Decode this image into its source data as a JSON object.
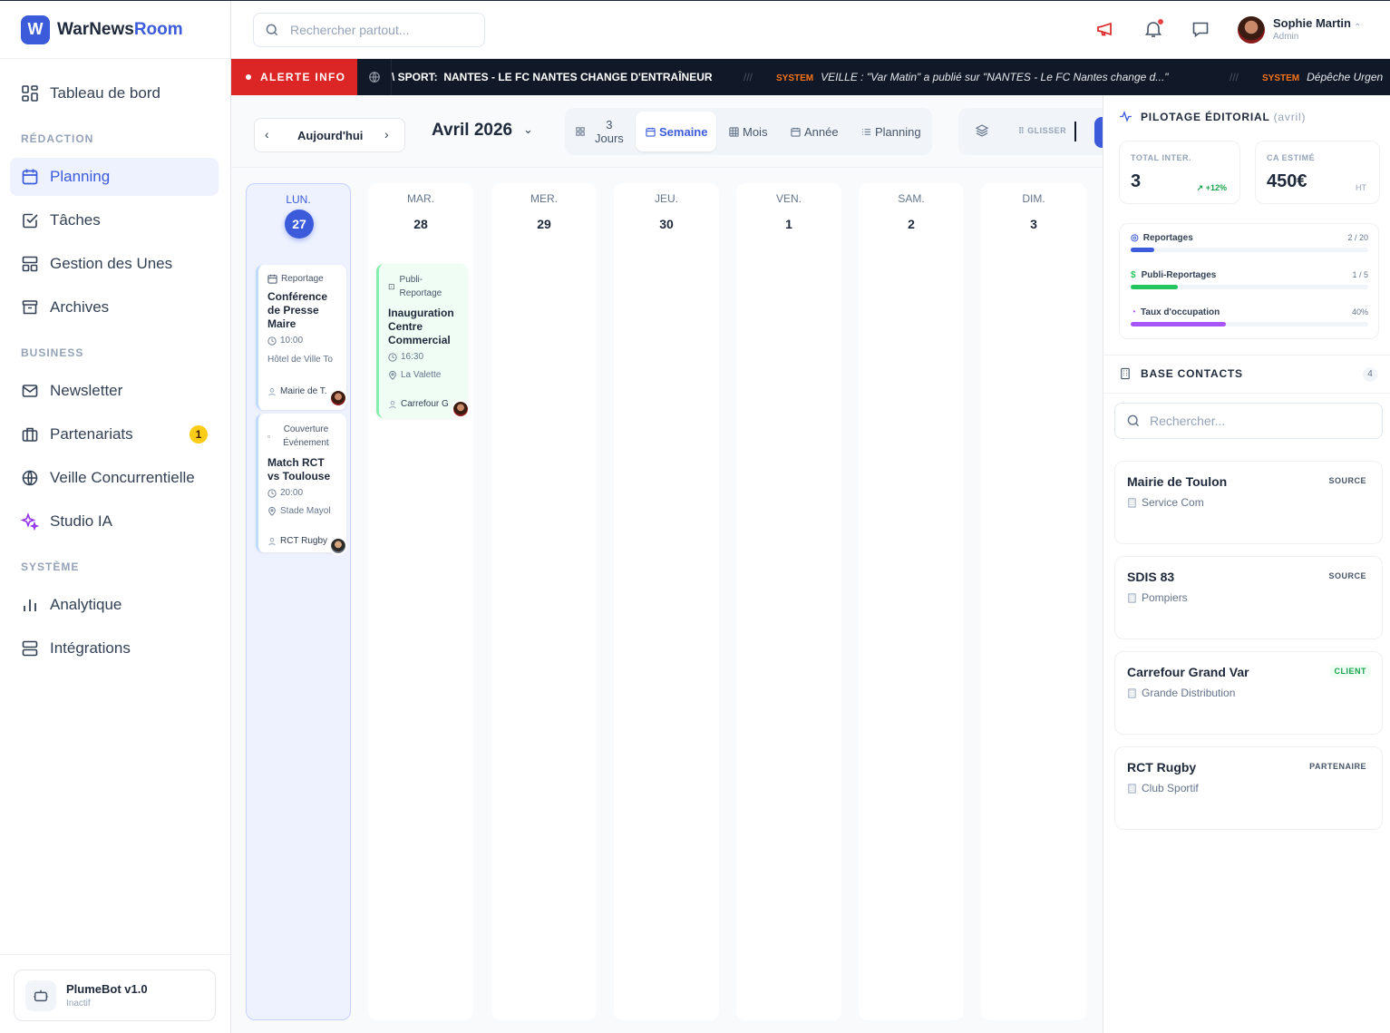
{
  "app": {
    "name_part1": "WarNews",
    "name_part2": "Room",
    "logo_letter": "W"
  },
  "sidebar": {
    "items": [
      {
        "label": "Tableau de bord"
      },
      {
        "label": "Planning"
      },
      {
        "label": "Tâches"
      },
      {
        "label": "Gestion des Unes"
      },
      {
        "label": "Archives"
      },
      {
        "label": "Newsletter"
      },
      {
        "label": "Partenariats",
        "badge": "1"
      },
      {
        "label": "Veille Concurrentielle"
      },
      {
        "label": "Studio IA"
      },
      {
        "label": "Analytique"
      },
      {
        "label": "Intégrations"
      }
    ],
    "sections": {
      "redaction": "RÉDACTION",
      "business": "BUSINESS",
      "systeme": "SYSTÈME"
    },
    "bot": {
      "name": "PlumeBot v1.0",
      "status": "Inactif"
    }
  },
  "header": {
    "search_placeholder": "Rechercher partout...",
    "user": {
      "name": "Sophie Martin",
      "role": "Admin"
    }
  },
  "ticker": {
    "alert_label": "ALERTE INFO",
    "item1_prefix": "\\ SPORT:",
    "item1_text": "NANTES - LE FC NANTES CHANGE D'ENTRAÎNEUR",
    "sep": "///",
    "item2_tag": "SYSTEM",
    "item2_text": "VEILLE : \"Var Matin\" a publié sur \"NANTES - Le FC Nantes change d...\"",
    "item3_tag": "SYSTEM",
    "item3_text": "Dépêche Urgen"
  },
  "toolbar": {
    "today": "Aujourd'hui",
    "month": "Avril 2026",
    "views": {
      "three_days_num": "3",
      "three_days_label": "Jours",
      "week": "Semaine",
      "month": "Mois",
      "year": "Année",
      "planning": "Planning"
    },
    "drag_label": "GLISSER"
  },
  "calendar": {
    "days": [
      {
        "name": "LUN.",
        "num": "27"
      },
      {
        "name": "MAR.",
        "num": "28"
      },
      {
        "name": "MER.",
        "num": "29"
      },
      {
        "name": "JEU.",
        "num": "30"
      },
      {
        "name": "VEN.",
        "num": "1"
      },
      {
        "name": "SAM.",
        "num": "2"
      },
      {
        "name": "DIM.",
        "num": "3"
      }
    ],
    "events": [
      {
        "type": "Reportage",
        "title": "Conférence de Presse Maire",
        "time": "10:00",
        "place": "Hôtel de Ville To",
        "owner": "Mairie de T."
      },
      {
        "type": "Couverture Événement",
        "title": "Match RCT vs Toulouse",
        "time": "20:00",
        "place": "Stade Mayol",
        "owner": "RCT Rugby"
      },
      {
        "type": "Publi-Reportage",
        "title": "Inauguration Centre Commercial",
        "time": "16:30",
        "place": "La Valette",
        "owner": "Carrefour G"
      }
    ]
  },
  "pilotage": {
    "title": "PILOTAGE ÉDITORIAL",
    "period": "(avril)",
    "total_label": "TOTAL INTER.",
    "total_value": "3",
    "total_trend": "+12%",
    "ca_label": "CA ESTIMÉ",
    "ca_value": "450€",
    "ca_unit": "HT",
    "progress": [
      {
        "label": "Reportages",
        "value": "2 / 20",
        "fraction": 0.1,
        "color": "#3b5bdb"
      },
      {
        "label": "Publi-Reportages",
        "value": "1 / 5",
        "fraction": 0.2,
        "color": "#22c55e"
      },
      {
        "label": "Taux d'occupation",
        "value": "40%",
        "fraction": 0.4,
        "color": "#a855f7"
      }
    ]
  },
  "contacts": {
    "title": "BASE CONTACTS",
    "count": "4",
    "search_placeholder": "Rechercher...",
    "items": [
      {
        "name": "Mairie de Toulon",
        "org": "Service Com",
        "tag": "SOURCE"
      },
      {
        "name": "SDIS 83",
        "org": "Pompiers",
        "tag": "SOURCE"
      },
      {
        "name": "Carrefour Grand Var",
        "org": "Grande Distribution",
        "tag": "CLIENT"
      },
      {
        "name": "RCT Rugby",
        "org": "Club Sportif",
        "tag": "PARTENAIRE"
      }
    ]
  },
  "colors": {
    "accent": "#3b5bdb",
    "alert": "#dc2626",
    "ticker_bg": "#111827"
  }
}
